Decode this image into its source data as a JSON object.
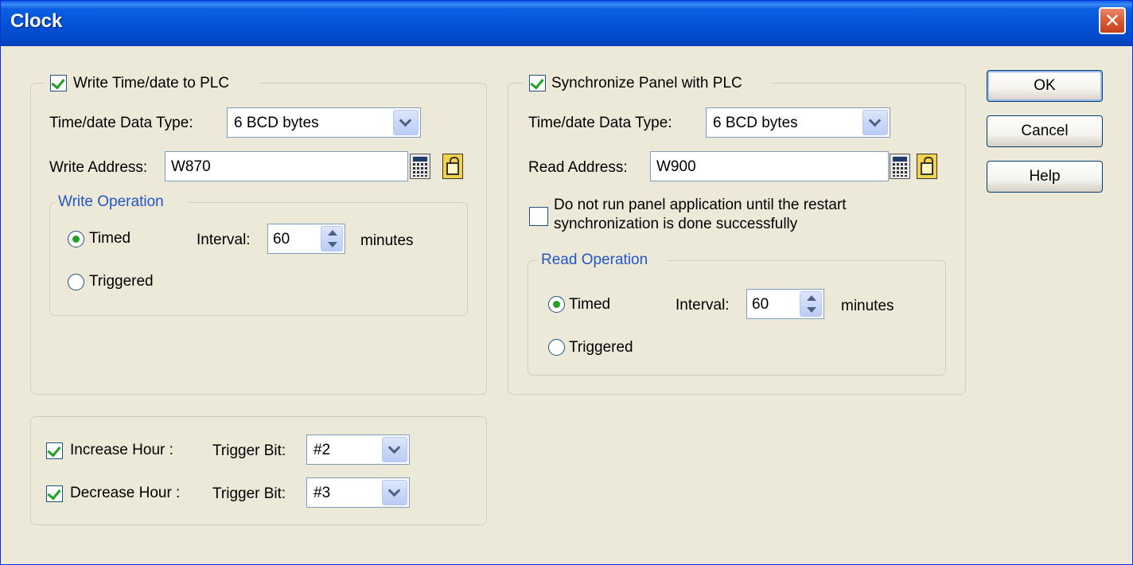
{
  "window": {
    "title": "Clock",
    "close_glyph": "✕"
  },
  "write_group": {
    "checkbox_label": "Write Time/date to PLC",
    "checked": true,
    "data_type_label": "Time/date Data Type:",
    "data_type_value": "6 BCD bytes",
    "address_label": "Write Address:",
    "address_value": "W870",
    "operation": {
      "legend": "Write Operation",
      "timed_label": "Timed",
      "triggered_label": "Triggered",
      "selected": "Timed",
      "interval_label": "Interval:",
      "interval_value": "60",
      "interval_unit": "minutes"
    }
  },
  "sync_group": {
    "checkbox_label": "Synchronize Panel with PLC",
    "checked": true,
    "data_type_label": "Time/date Data Type:",
    "data_type_value": "6 BCD bytes",
    "address_label": "Read Address:",
    "address_value": "W900",
    "restart_line1": "Do not run panel application until the restart",
    "restart_line2": "synchronization is done successfully",
    "restart_checked": false,
    "operation": {
      "legend": "Read Operation",
      "timed_label": "Timed",
      "triggered_label": "Triggered",
      "selected": "Timed",
      "interval_label": "Interval:",
      "interval_value": "60",
      "interval_unit": "minutes"
    }
  },
  "hour_group": {
    "increase_label": "Increase Hour :",
    "increase_checked": true,
    "increase_trigger_label": "Trigger Bit:",
    "increase_trigger_value": "#2",
    "decrease_label": "Decrease Hour :",
    "decrease_checked": true,
    "decrease_trigger_label": "Trigger Bit:",
    "decrease_trigger_value": "#3"
  },
  "buttons": {
    "ok": "OK",
    "cancel": "Cancel",
    "help": "Help"
  },
  "icons": [
    "calculator-icon",
    "tag-icon",
    "close-icon",
    "chevron-down-icon",
    "spin-up-icon",
    "spin-down-icon"
  ]
}
